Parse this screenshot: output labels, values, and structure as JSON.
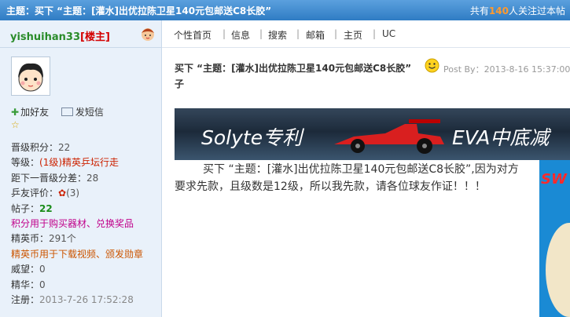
{
  "topbar": {
    "title": "主题：买下 “主题：[灌水]出优拉陈卫星140元包邮送C8长胶”",
    "follow_prefix": "共有",
    "follow_count": "140",
    "follow_suffix": "人关注过本帖"
  },
  "user": {
    "name": "yishuihan33",
    "role": "[楼主]",
    "add_friend": "加好友",
    "send_msg": "发短信",
    "stars": "☆",
    "info": {
      "jifen_label": "晋级积分：",
      "jifen_value": "22",
      "level_label": "等级：",
      "level_value": "(1级)精英乒坛行走",
      "next_label": "距下一晋级分差：",
      "next_value": "28",
      "eval_label": "乒友评价：",
      "eval_value": "(3)",
      "tiezi_label": "帖子：",
      "tiezi_value": "22",
      "jifen_note": "积分用于购买器材、兑换奖品",
      "jyb_label": "精英币：",
      "jyb_value": "291个",
      "jyb_note": "精英币用于下载视频、颁发勋章",
      "weiwang_label": "威望：",
      "weiwang_value": "0",
      "jinghua_label": "精华：",
      "jinghua_value": "0",
      "reg_label": "注册：",
      "reg_value": "2013-7-26 17:52:28"
    }
  },
  "nav": {
    "items": [
      "个性首页",
      "信息",
      "搜索",
      "邮箱",
      "主页",
      "UC"
    ],
    "sep": "|"
  },
  "post": {
    "title_line1": "买下 “主题：[灌水]出优拉陈卫星140元包邮送C8长胶”",
    "title_line2": "子",
    "post_by": "Post By：2013-8-16 15:37:00",
    "banner_left": "Solyte专利",
    "banner_right": "EVA中底减",
    "body": "买下 “主题：[灌水]出优拉陈卫星140元包邮送C8长胶”,因为对方要求先款，且级数是12级，所以我先款，请各位球友作证！！！"
  },
  "colors": {
    "topbar": "#2f7cc4",
    "sidebar": "#e9f1fa",
    "username": "#2a8c2a",
    "role": "#d40000"
  }
}
